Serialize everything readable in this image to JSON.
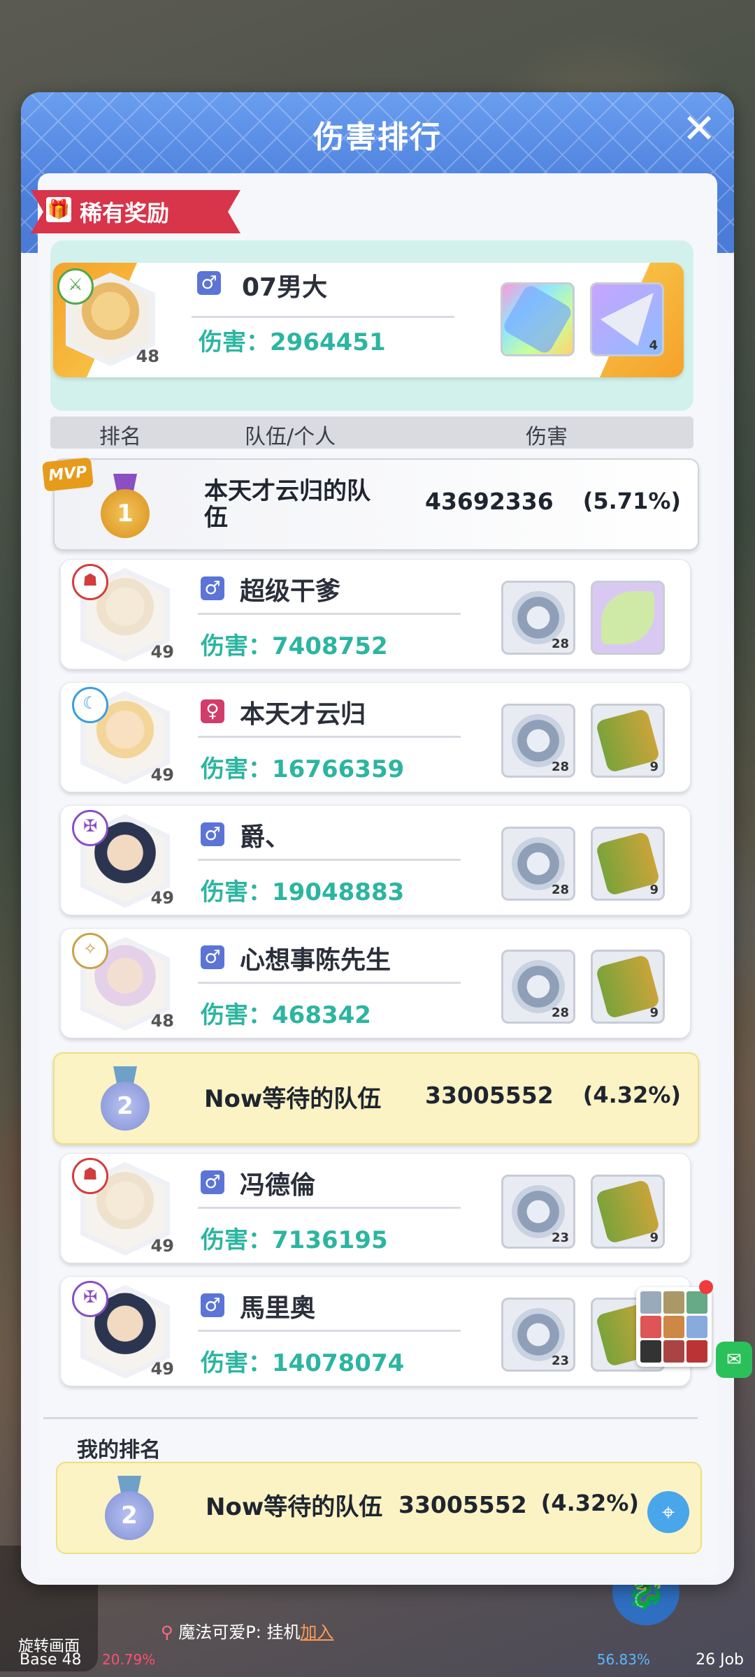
{
  "panel": {
    "title": "伤害排行",
    "close_label": "✕"
  },
  "rare_reward": {
    "tag_label": "稀有奖励",
    "player": {
      "gender": "male",
      "gender_symbol": "♂",
      "name": "07男大",
      "damage_label": "伤害：2964451",
      "level": "48"
    },
    "items": [
      {
        "icon": "crystal-scroll-icon",
        "count": ""
      },
      {
        "icon": "triangle-shard-icon",
        "count": "4"
      }
    ]
  },
  "table_header": {
    "rank": "排名",
    "team": "队伍/个人",
    "damage": "伤害"
  },
  "teams": [
    {
      "rank": "1",
      "badge": "MVP",
      "name": "本天才云归的队伍",
      "damage": "43692336",
      "percent": "(5.71%)"
    },
    {
      "rank": "2",
      "name": "Now等待的队伍",
      "damage": "33005552",
      "percent": "(4.32%)"
    }
  ],
  "players": [
    {
      "gender": "male",
      "gender_symbol": "♂",
      "name": "超级干爹",
      "damage_label": "伤害：7408752",
      "level": "49",
      "items": [
        {
          "icon": "helmet-coin-icon",
          "count": "28"
        },
        {
          "icon": "fairy-wing-icon",
          "count": ""
        }
      ]
    },
    {
      "gender": "female",
      "gender_symbol": "♀",
      "name": "本天才云归",
      "damage_label": "伤害：16766359",
      "level": "49",
      "items": [
        {
          "icon": "helmet-coin-icon",
          "count": "28"
        },
        {
          "icon": "panda-bamboo-icon",
          "count": "9"
        }
      ]
    },
    {
      "gender": "male",
      "gender_symbol": "♂",
      "name": "爵、",
      "damage_label": "伤害：19048883",
      "level": "49",
      "items": [
        {
          "icon": "helmet-coin-icon",
          "count": "28"
        },
        {
          "icon": "panda-bamboo-icon",
          "count": "9"
        }
      ]
    },
    {
      "gender": "male",
      "gender_symbol": "♂",
      "name": "心想事陈先生",
      "damage_label": "伤害：468342",
      "level": "48",
      "items": [
        {
          "icon": "helmet-coin-icon",
          "count": "28"
        },
        {
          "icon": "panda-bamboo-icon",
          "count": "9"
        }
      ]
    },
    {
      "gender": "male",
      "gender_symbol": "♂",
      "name": "冯德倫",
      "damage_label": "伤害：7136195",
      "level": "49",
      "items": [
        {
          "icon": "helmet-coin-icon",
          "count": "23"
        },
        {
          "icon": "panda-bamboo-icon",
          "count": "9"
        }
      ]
    },
    {
      "gender": "male",
      "gender_symbol": "♂",
      "name": "馬里奧",
      "damage_label": "伤害：14078074",
      "level": "49",
      "items": [
        {
          "icon": "helmet-coin-icon",
          "count": "23"
        },
        {
          "icon": "panda-bamboo-icon",
          "count": ""
        }
      ]
    }
  ],
  "my_rank": {
    "label": "我的排名",
    "rank": "2",
    "name": "Now等待的队伍",
    "damage": "33005552",
    "percent": "(4.32%)"
  },
  "game_ui": {
    "rotate_label": "旋转画面",
    "chat": [
      {
        "speaker": "魔法可爱P:",
        "text": "挂机",
        "link": "加入"
      }
    ],
    "base_label": "Base  48",
    "base_pct": "20.79%",
    "job_pct": "56.83%",
    "job_label": "26  Job"
  },
  "colors": {
    "accent": "#4d80dc",
    "damage_text": "#2cb5a0",
    "gold_medal": "#e6a523",
    "silver_medal": "#7f8fd6"
  }
}
